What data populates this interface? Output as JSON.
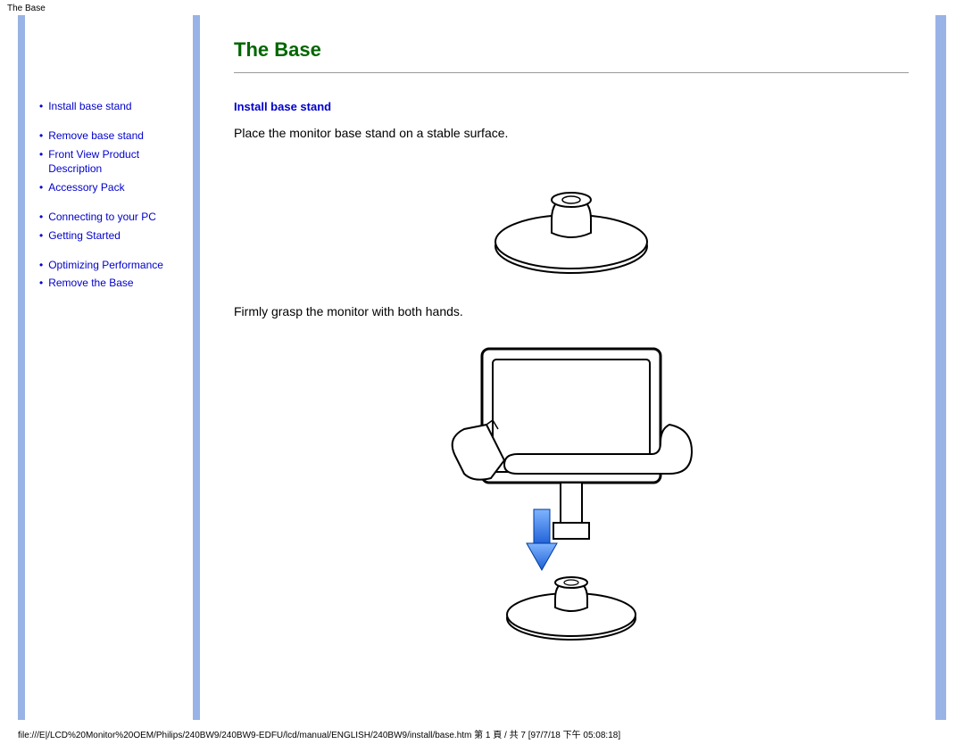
{
  "topLabel": "The Base",
  "sidebar": {
    "items": [
      {
        "label": "Install base stand"
      },
      {
        "label": "Remove base stand"
      },
      {
        "label": "Front View Product Description"
      },
      {
        "label": "Accessory Pack"
      },
      {
        "label": "Connecting to your PC"
      },
      {
        "label": "Getting Started"
      },
      {
        "label": "Optimizing Performance"
      },
      {
        "label": "Remove the Base"
      }
    ]
  },
  "content": {
    "title": "The Base",
    "sectionHead": "Install base stand",
    "step1": "Place the monitor base stand on a stable surface.",
    "step2": "Firmly grasp the monitor with both hands."
  },
  "footer": "file:///E|/LCD%20Monitor%20OEM/Philips/240BW9/240BW9-EDFU/lcd/manual/ENGLISH/240BW9/install/base.htm 第 1 頁 / 共 7  [97/7/18 下午 05:08:18]"
}
